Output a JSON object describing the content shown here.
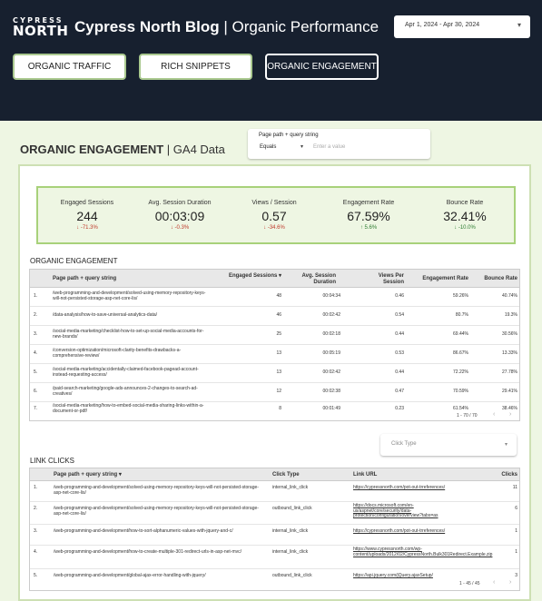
{
  "header": {
    "logo_top": "CYPRESS",
    "logo_bottom": "NORTH",
    "title_bold": "Cypress North Blog",
    "title_sep": " | ",
    "title_rest": "Organic Performance",
    "date_range": "Apr 1, 2024 - Apr 30, 2024",
    "date_chevron": "▾"
  },
  "nav": {
    "organic_traffic": "ORGANIC TRAFFIC",
    "rich_snippets": "RICH SNIPPETS",
    "organic_engagement": "ORGANIC ENGAGEMENT"
  },
  "section": {
    "title_bold": "ORGANIC ENGAGEMENT",
    "title_sep": " | ",
    "title_rest": "GA4 Data"
  },
  "filter": {
    "label": "Page path + query string",
    "operator": "Equals",
    "operator_chevron": "▾",
    "placeholder": "Enter a value"
  },
  "kpis": [
    {
      "label": "Engaged Sessions",
      "value": "244",
      "delta": "↓ -71.3%",
      "direction": "down"
    },
    {
      "label": "Avg. Session Duration",
      "value": "00:03:09",
      "delta": "↓ -0.3%",
      "direction": "down"
    },
    {
      "label": "Views / Session",
      "value": "0.57",
      "delta": "↓ -34.6%",
      "direction": "down"
    },
    {
      "label": "Engagement Rate",
      "value": "67.59%",
      "delta": "↑ 5.6%",
      "direction": "up"
    },
    {
      "label": "Bounce Rate",
      "value": "32.41%",
      "delta": "↓ -10.0%",
      "direction": "down"
    }
  ],
  "engagement_table": {
    "title": "ORGANIC ENGAGEMENT",
    "headers": [
      "Page path + query string",
      "Engaged Sessions ▾",
      "Avg. Session Duration",
      "Views Per Session",
      "Engagement Rate",
      "Bounce Rate"
    ],
    "rows": [
      {
        "n": "1.",
        "path": "/web-programming-and-development/solved-using-memory-repository-keys-will-not-persisted-storage-asp-net-core-lis/",
        "sessions": "48",
        "duration": "00:04:34",
        "views": "0.46",
        "eng": "59.26%",
        "bounce": "40.74%"
      },
      {
        "n": "2.",
        "path": "/data-analysis/how-to-save-universal-analytics-data/",
        "sessions": "46",
        "duration": "00:02:42",
        "views": "0.54",
        "eng": "80.7%",
        "bounce": "19.3%"
      },
      {
        "n": "3.",
        "path": "/social-media-marketing/checklist-how-to-set-up-social-media-accounts-for-new-brands/",
        "sessions": "25",
        "duration": "00:02:18",
        "views": "0.44",
        "eng": "69.44%",
        "bounce": "30.56%"
      },
      {
        "n": "4.",
        "path": "/conversion-optimization/microsoft-clarity-benefits-drawbacks-a-comprehensive-review/",
        "sessions": "13",
        "duration": "00:05:19",
        "views": "0.53",
        "eng": "86.67%",
        "bounce": "13.33%"
      },
      {
        "n": "5.",
        "path": "/social-media-marketing/accidentally-claimed-facebook-pagead-account-instead-requesting-access/",
        "sessions": "13",
        "duration": "00:02:42",
        "views": "0.44",
        "eng": "72.22%",
        "bounce": "27.78%"
      },
      {
        "n": "6.",
        "path": "/paid-search-marketing/google-ads-announces-2-changes-to-search-ad-creatives/",
        "sessions": "12",
        "duration": "00:02:38",
        "views": "0.47",
        "eng": "70.59%",
        "bounce": "29.41%"
      },
      {
        "n": "7.",
        "path": "/social-media-marketing/how-to-embed-social-media-sharing-links-within-a-document-or-pdf/",
        "sessions": "8",
        "duration": "00:01:49",
        "views": "0.23",
        "eng": "61.54%",
        "bounce": "38.46%"
      }
    ],
    "pagination": "1 - 70 / 70",
    "prev": "‹",
    "next": "›"
  },
  "link_clicks": {
    "title": "LINK CLICKS",
    "dropdown_label": "Click Type",
    "dropdown_chevron": "▾",
    "headers": [
      "Page path + query string ▾",
      "Click Type",
      "Link URL",
      "Clicks"
    ],
    "rows": [
      {
        "n": "1.",
        "path": "/web-programming-and-development/solved-using-memory-repository-keys-will-not-persisted-storage-asp-net-core-lis/",
        "type": "internal_link_click",
        "url": "https://cypressnorth.com/pot-out-trreferences/",
        "clicks": "11"
      },
      {
        "n": "2.",
        "path": "/web-programming-and-development/solved-using-memory-repository-keys-will-not-persisted-storage-asp-net-core-lis/",
        "type": "outbound_link_click",
        "url": "https://docs.microsoft.com/en-us/aspnet/core/security/data-protection/configuration/overview?tabs=as",
        "clicks": "6"
      },
      {
        "n": "3.",
        "path": "/web-programming-and-development/how-to-sort-alphanumeric-values-with-jquery-and-c/",
        "type": "internal_link_click",
        "url": "https://cypressnorth.com/pot-out-trreferences/",
        "clicks": "1"
      },
      {
        "n": "4.",
        "path": "/web-programming-and-development/how-to-create-multiple-301-redirect-urls-in-asp-net-mvc/",
        "type": "internal_link_click",
        "url": "https://www.cypressnorth.com/wp-content/uploads/2012/02/CypressNorth.Bulk301Redirect.Example.zip",
        "clicks": "1"
      },
      {
        "n": "5.",
        "path": "/web-programming-and-development/global-ajax-error-handling-with-jquery/",
        "type": "outbound_link_click",
        "url": "https://api.jquery.com/jQuery.ajaxSetup/",
        "clicks": "3"
      }
    ],
    "pagination": "1 - 45 / 45",
    "prev": "‹",
    "next": "›"
  }
}
